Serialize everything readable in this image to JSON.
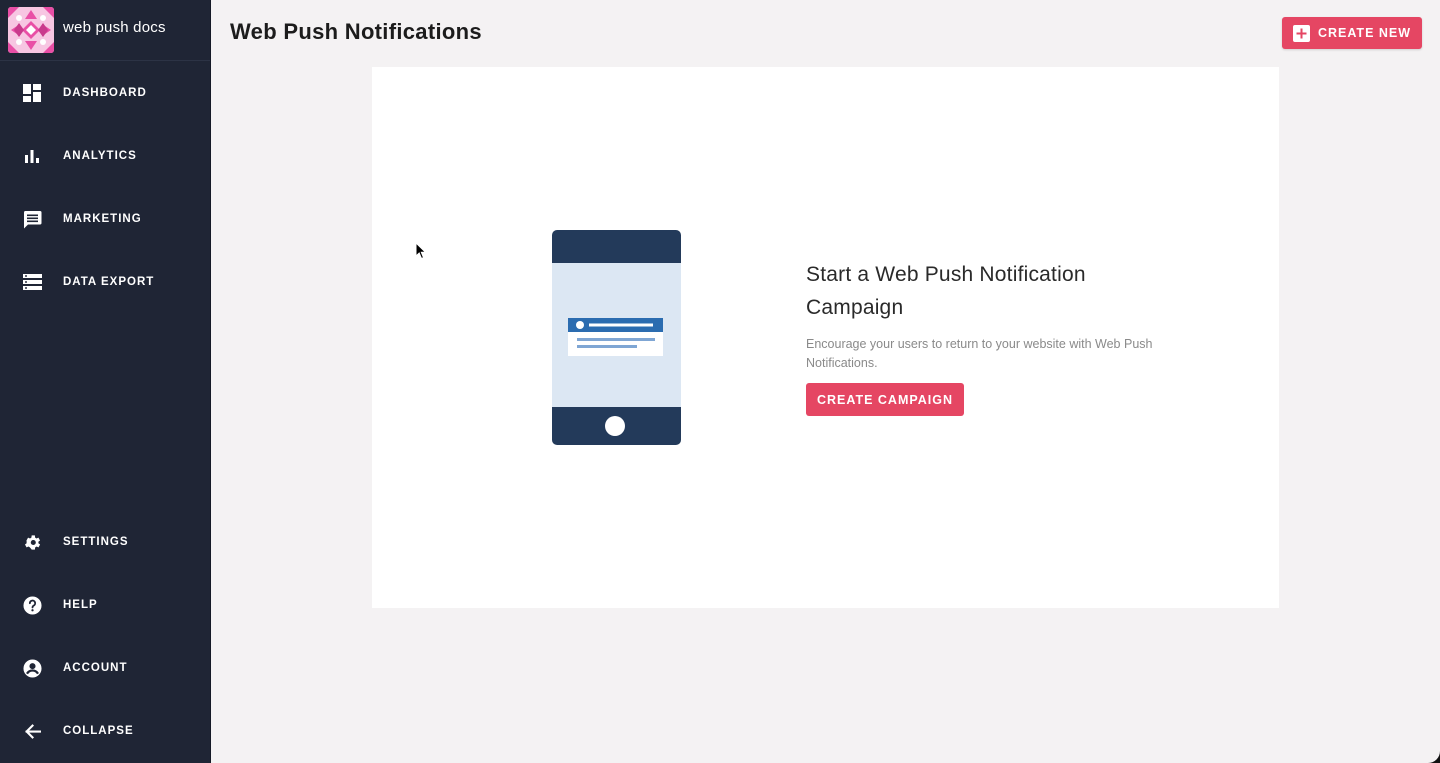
{
  "brand": {
    "name": "web push docs"
  },
  "header": {
    "title": "Web Push Notifications",
    "create_new_label": "CREATE NEW"
  },
  "sidebar": {
    "items": [
      {
        "label": "DASHBOARD",
        "icon": "dashboard-icon"
      },
      {
        "label": "ANALYTICS",
        "icon": "bar-chart-icon"
      },
      {
        "label": "MARKETING",
        "icon": "message-icon"
      },
      {
        "label": "DATA EXPORT",
        "icon": "list-icon"
      }
    ],
    "bottom_items": [
      {
        "label": "SETTINGS",
        "icon": "gear-icon"
      },
      {
        "label": "HELP",
        "icon": "help-icon"
      },
      {
        "label": "ACCOUNT",
        "icon": "account-icon"
      },
      {
        "label": "COLLAPSE",
        "icon": "arrow-left-icon"
      }
    ]
  },
  "empty_state": {
    "title": "Start a Web Push Notification Campaign",
    "description": "Encourage your users to return to your website with Web Push Notifications.",
    "button_label": "CREATE CAMPAIGN"
  },
  "colors": {
    "accent": "#e54663",
    "sidebar_bg": "#1f2535",
    "page_bg": "#f4f2f3",
    "phone_dark": "#233a5a",
    "phone_screen": "#dce7f3",
    "notification_blue": "#2b6cb0"
  }
}
